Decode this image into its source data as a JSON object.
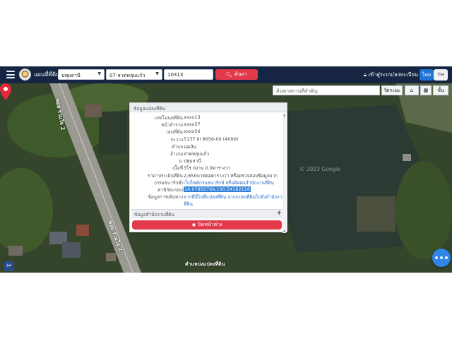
{
  "header": {
    "app_title": "แผนที่ที่ดิน",
    "province_value": "ปทุมธานี",
    "district_value": "07-ลาดหลุมแก้ว",
    "parcel_value": "10313",
    "search_label": "ค้นหา",
    "login_label": "เข้าสู่ระบบ/ลงทะเบียน",
    "lang_th": "ไทย",
    "lang_en": "TH"
  },
  "map": {
    "place_search_placeholder": "ค้นหาสถานที่สำคัญ",
    "measure_label": "วัดระยะ",
    "layers_label": "ชั้น",
    "road_label_1": "ซอย ร่วมใจ 2",
    "road_label_2": "ซอย ร่วมใจ 2",
    "copyright": "© 2023 Google",
    "marker_label": "ตำแหน่งแปลงที่ดิน",
    "more_label": "•••"
  },
  "popup": {
    "header": "ข้อมูลแปลงที่ดิน",
    "rows": [
      {
        "label": "เลขโฉนดที่ดิน",
        "value": "xxxx13"
      },
      {
        "label": "หน้าสำรวจ",
        "value": "xxxx57"
      },
      {
        "label": "เลขที่ดิน",
        "value": "xxxx56"
      },
      {
        "label": "ระวาง",
        "value": "5137 III 6656-00 (4000)"
      },
      {
        "label": "ตำบล",
        "value": "บ่อเงิน"
      },
      {
        "label": "อำเภอ",
        "value": "ลาดหลุมแก้ว"
      },
      {
        "label": "จ.",
        "value": "ปทุมธานี"
      },
      {
        "label": "เนื้อที่",
        "value": "3ไร่ 0งาน 0.0ตารางวา"
      },
      {
        "label": "ราคาประเมินที่ดิน",
        "value": "2,650บาทต่อตารางวา หรือตรวจสอบข้อมูลจาก"
      },
      {
        "label": "(กรมธนารักษ์)",
        "value": "เว็บไซต์กรมธนารักษ์ หรือติดต่อสำนักงานที่ดิน"
      },
      {
        "label": "ค่าพิกัดแปลง",
        "value": "14.07850769,100.54162126"
      },
      {
        "label": "ข้อมูลการเดินทาง",
        "value": "จากที่นี่ไปที่แปลงที่ดิน จากแปลงที่ดินไปยังสำนักงาน"
      },
      {
        "label": "",
        "value": "ที่ดิน"
      }
    ],
    "section2_label": "ข้อมูลสำนักงานที่ดิน",
    "close_label": "ปิดหน้าต่าง"
  }
}
